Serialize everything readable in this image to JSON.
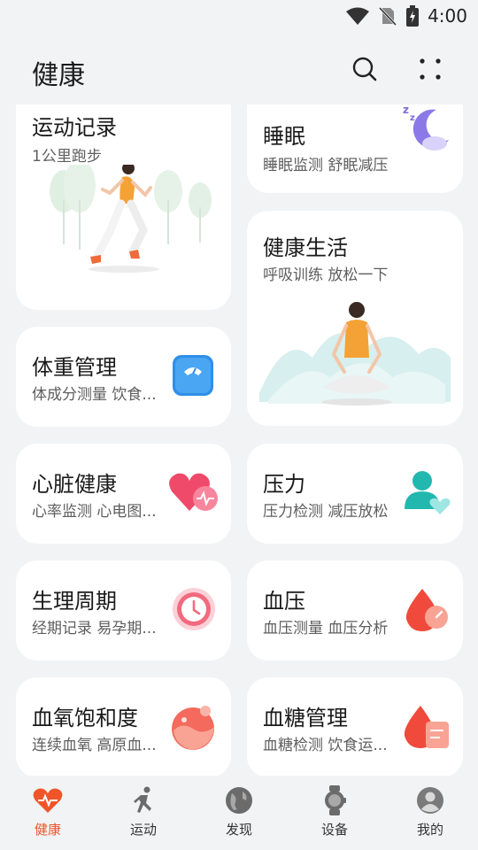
{
  "status": {
    "time": "4:00"
  },
  "header": {
    "title": "健康"
  },
  "cards": {
    "exercise": {
      "title": "运动记录",
      "subtitle": "1公里跑步"
    },
    "sleep": {
      "title": "睡眠",
      "subtitle": "睡眠监测 舒眠减压"
    },
    "wellness": {
      "title": "健康生活",
      "subtitle": "呼吸训练 放松一下"
    },
    "weight": {
      "title": "体重管理",
      "subtitle": "体成分测量 饮食..."
    },
    "heart": {
      "title": "心脏健康",
      "subtitle": "心率监测 心电图..."
    },
    "stress": {
      "title": "压力",
      "subtitle": "压力检测 减压放松"
    },
    "cycle": {
      "title": "生理周期",
      "subtitle": "经期记录 易孕期..."
    },
    "bp": {
      "title": "血压",
      "subtitle": "血压测量 血压分析"
    },
    "spo2": {
      "title": "血氧饱和度",
      "subtitle": "连续血氧 高原血..."
    },
    "glucose": {
      "title": "血糖管理",
      "subtitle": "血糖检测 饮食运..."
    }
  },
  "nav": [
    {
      "label": "健康",
      "icon": "heart-pulse-icon",
      "active": true
    },
    {
      "label": "运动",
      "icon": "running-icon",
      "active": false
    },
    {
      "label": "发现",
      "icon": "globe-icon",
      "active": false
    },
    {
      "label": "设备",
      "icon": "watch-icon",
      "active": false
    },
    {
      "label": "我的",
      "icon": "profile-icon",
      "active": false
    }
  ],
  "colors": {
    "accent": "#f0552a",
    "background": "#f1f3f5",
    "card": "#ffffff"
  }
}
